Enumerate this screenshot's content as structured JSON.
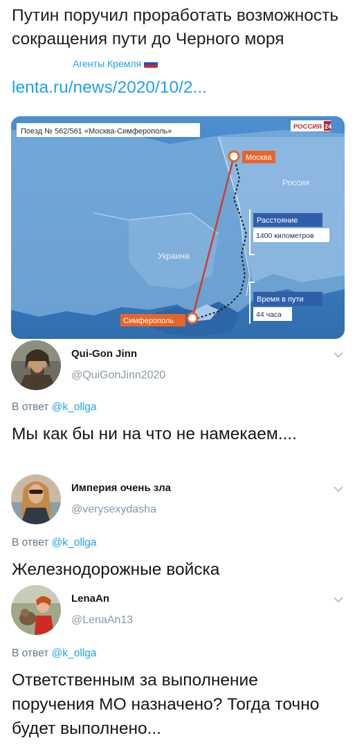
{
  "post": {
    "headline": "Путин поручил проработать возможность сокращения пути до Черного моря",
    "source": "Агенты Кремля",
    "link": "lenta.ru/news/2020/10/2..."
  },
  "map": {
    "title": "Поезд № 562/561 «Москва-Симферополь»",
    "channel": "РОССИЯ",
    "channel_num": "24",
    "city_from": "Москва",
    "city_to": "Симферополь",
    "country_russia": "Россия",
    "country_ukraine": "Украина",
    "distance_label": "Расстояние",
    "distance_value": "1400 километров",
    "time_label": "Время в пути",
    "time_value": "44 часа"
  },
  "tweets": [
    {
      "author": "Qui-Gon Jinn",
      "handle": "@QuiGonJinn2020",
      "reply_prefix": "В ответ",
      "reply_to": "@k_ollga",
      "text": "Мы как бы ни на что не намекаем...."
    },
    {
      "author": "Империя очень зла",
      "handle": "@verysexydasha",
      "reply_prefix": "В ответ",
      "reply_to": "@k_ollga",
      "text": "Железнодорожные войска"
    },
    {
      "author": "LenaAn",
      "handle": "@LenaAn13",
      "reply_prefix": "В ответ",
      "reply_to": "@k_ollga",
      "text": "Ответственным за выполнение поручения МО назначено? Тогда точно будет выполнено..."
    }
  ],
  "colors": {
    "link": "#1da1f2",
    "muted": "#8899a6",
    "accent_map": "#e8652a"
  }
}
